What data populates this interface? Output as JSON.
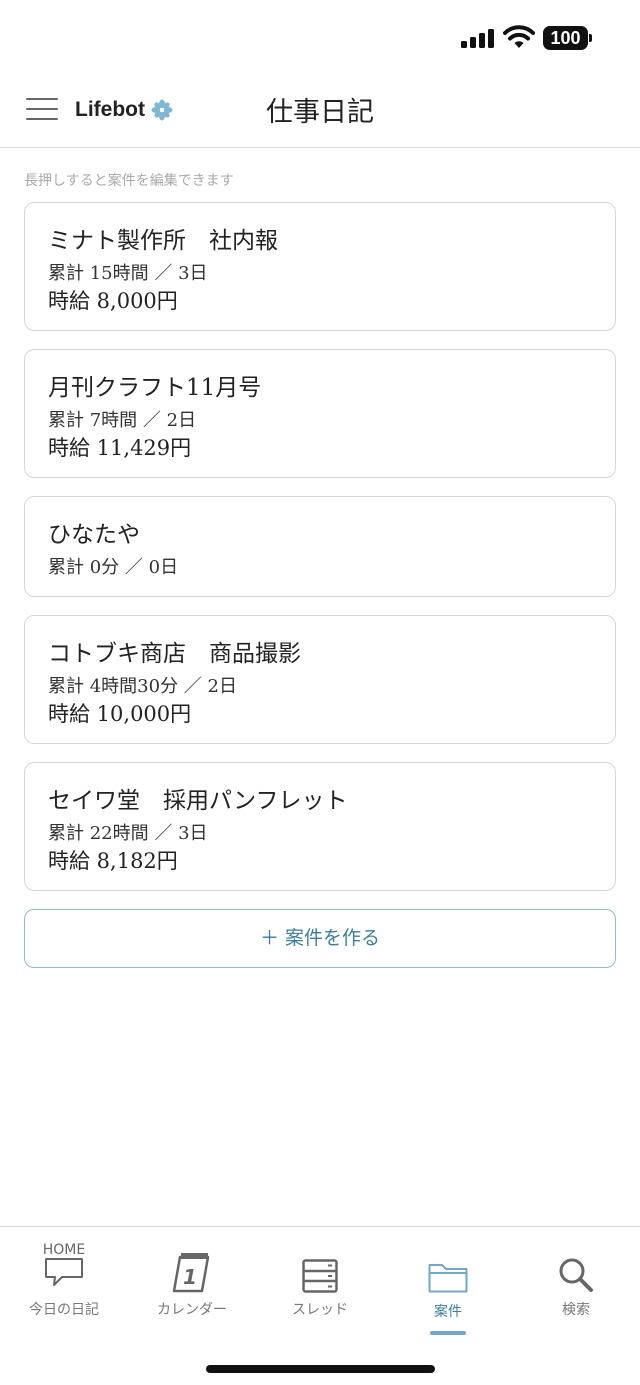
{
  "status_bar": {
    "battery": "100"
  },
  "header": {
    "brand": "Lifebot",
    "title": "仕事日記"
  },
  "hint": "長押しすると案件を編集できます",
  "projects": [
    {
      "title": "ミナト製作所　社内報",
      "total": "累計 15時間 ／ 3日",
      "rate": "時給 8,000円"
    },
    {
      "title": "月刊クラフト11月号",
      "total": "累計 7時間 ／ 2日",
      "rate": "時給 11,429円"
    },
    {
      "title": "ひなたや",
      "total": "累計 0分 ／ 0日",
      "rate": ""
    },
    {
      "title": "コトブキ商店　商品撮影",
      "total": "累計 4時間30分 ／ 2日",
      "rate": "時給 10,000円"
    },
    {
      "title": "セイワ堂　採用パンフレット",
      "total": "累計 22時間 ／ 3日",
      "rate": "時給 8,182円"
    }
  ],
  "create_button": "＋ 案件を作る",
  "tabs": [
    {
      "label": "今日の日記",
      "icon": "home-chat-icon",
      "icon_text": "HOME"
    },
    {
      "label": "カレンダー",
      "icon": "calendar-icon",
      "icon_text": "1"
    },
    {
      "label": "スレッド",
      "icon": "thread-icon"
    },
    {
      "label": "案件",
      "icon": "folder-icon",
      "active": true
    },
    {
      "label": "検索",
      "icon": "search-icon"
    }
  ],
  "colors": {
    "accent": "#3b7ea0",
    "accent_light": "#8fbcd0"
  }
}
